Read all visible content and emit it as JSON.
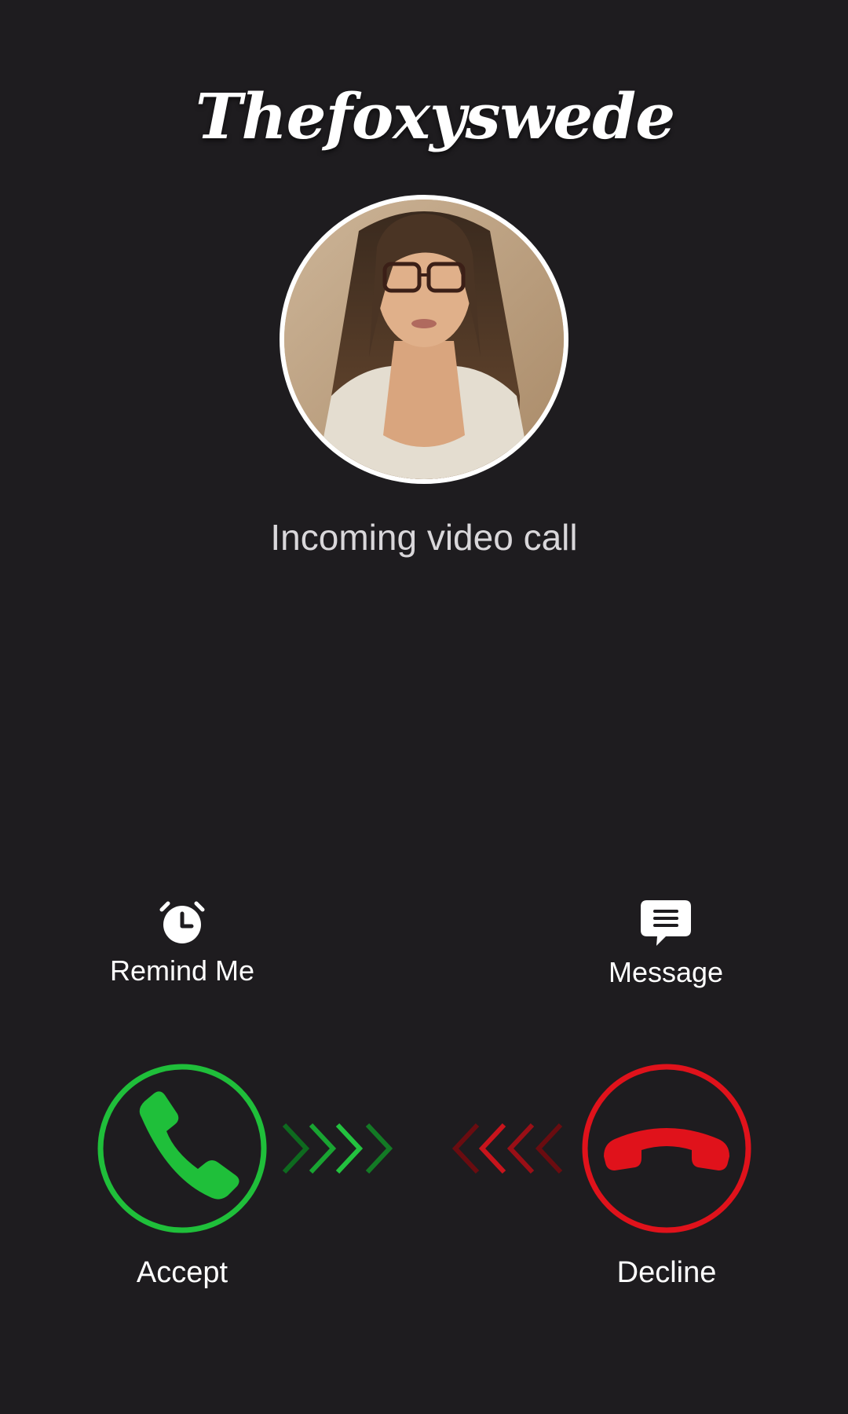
{
  "caller": {
    "name": "Thefoxyswede",
    "status": "Incoming video call"
  },
  "actions": {
    "remind_me": {
      "label": "Remind Me",
      "icon": "alarm-clock-icon"
    },
    "message": {
      "label": "Message",
      "icon": "message-bubble-icon"
    }
  },
  "call_buttons": {
    "accept": {
      "label": "Accept",
      "icon": "phone-icon",
      "color": "#1fbf3a"
    },
    "decline": {
      "label": "Decline",
      "icon": "hang-up-icon",
      "color": "#e0121b"
    }
  },
  "theme": {
    "background": "#1e1c1f",
    "text": "#ffffff",
    "status_text": "#d9d7da"
  }
}
